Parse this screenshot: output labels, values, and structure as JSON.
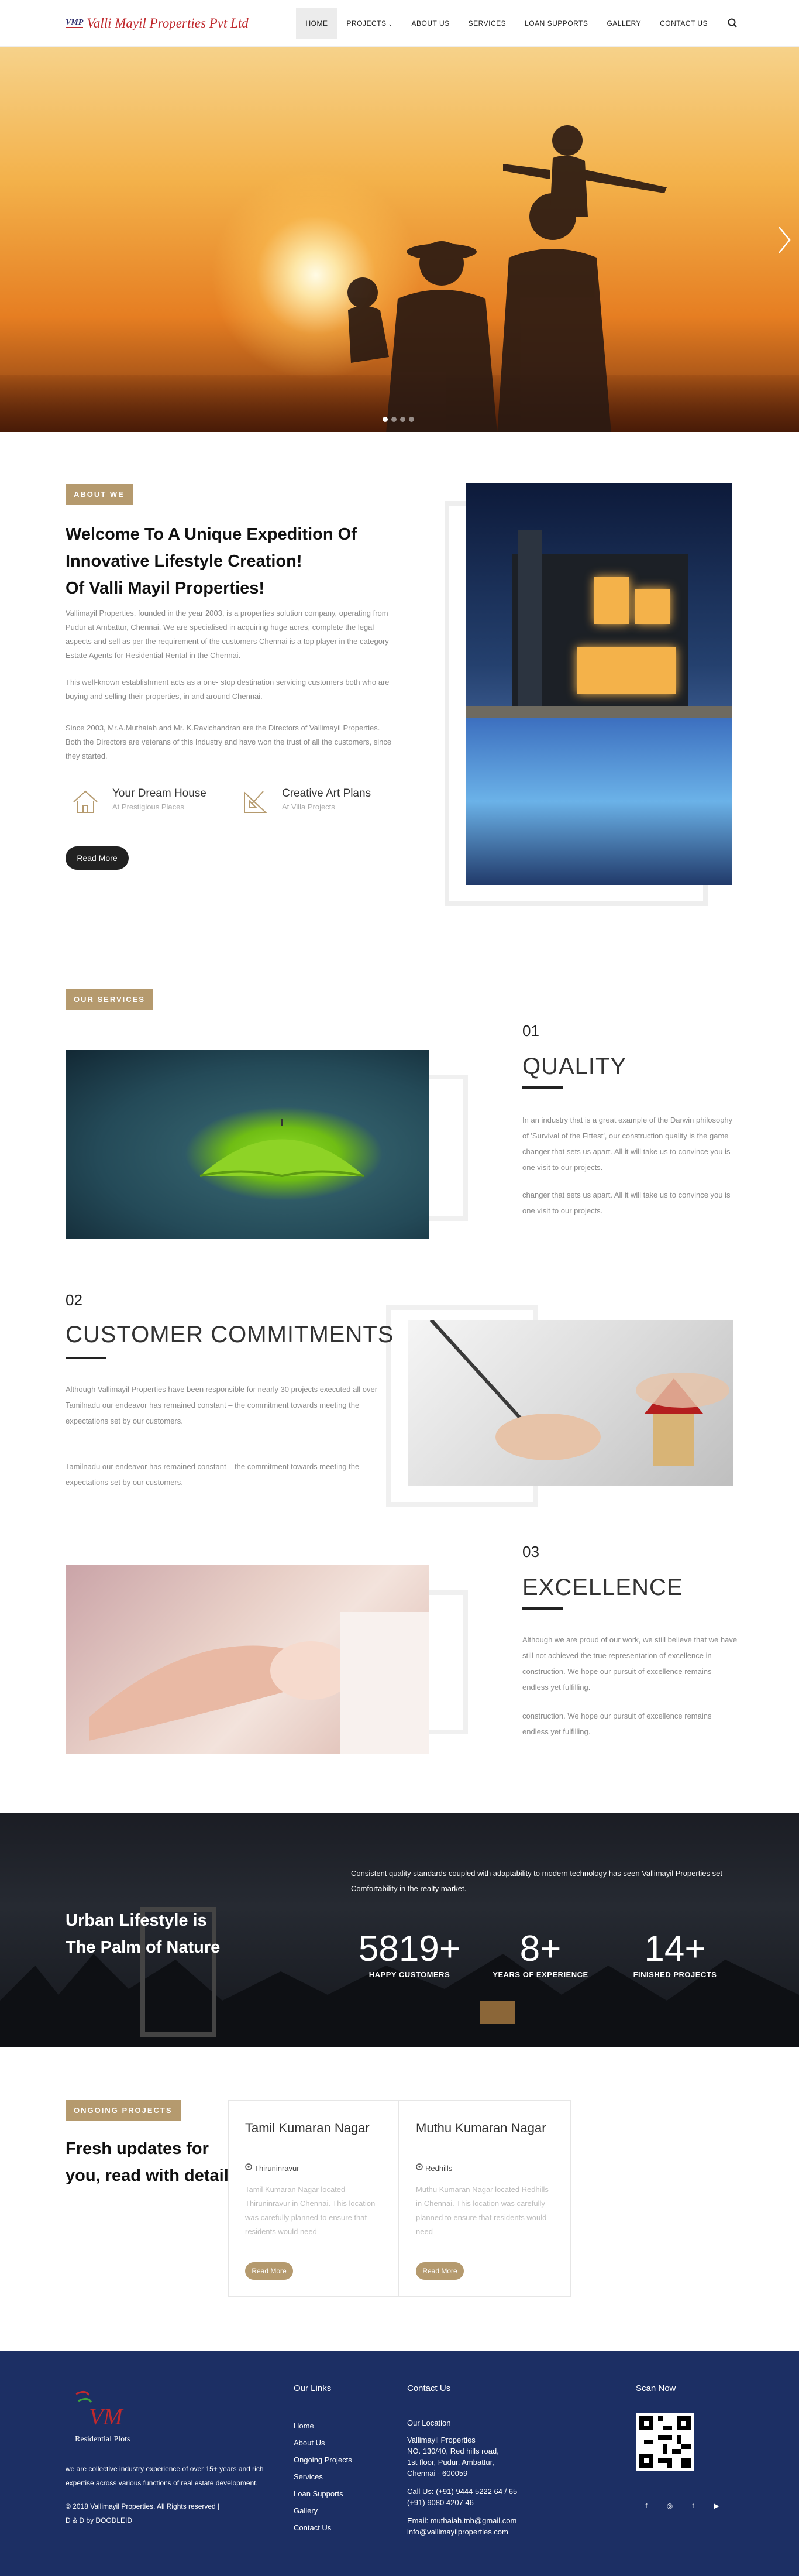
{
  "header": {
    "logo_mark": "VMP",
    "logo_name": "Valli Mayil Properties Pvt Ltd",
    "nav": [
      {
        "label": "HOME"
      },
      {
        "label": "PROJECTS"
      },
      {
        "label": "ABOUT US"
      },
      {
        "label": "SERVICES"
      },
      {
        "label": "LOAN SUPPORTS"
      },
      {
        "label": "GALLERY"
      },
      {
        "label": "CONTACT US"
      }
    ],
    "projects_caret": "⌄"
  },
  "hero": {
    "next_arrow": "›",
    "slides": 4,
    "active_slide": 1
  },
  "about": {
    "tag": "ABOUT WE",
    "title_lines": [
      "Welcome To A Unique Expedition Of",
      "Innovative Lifestyle Creation!",
      "Of Valli Mayil Properties!"
    ],
    "p1": "Vallimayil Properties, founded in the year 2003, is a properties solution company, operating from Pudur at Ambattur, Chennai. We are specialised in acquiring huge acres, complete the legal aspects and sell as per the requirement of the customers Chennai is a top player in the category Estate Agents for Residential Rental in the Chennai.",
    "p2": "This well-known establishment acts as a one- stop destination servicing customers both who are buying and selling their properties, in and around Chennai.",
    "p3": "Since 2003, Mr.A.Muthaiah and Mr. K.Ravichandran are the Directors of Vallimayil Properties. Both the Directors are veterans of this Industry and have won the trust of all the customers, since they started.",
    "features": [
      {
        "title": "Your Dream House",
        "sub": "At Prestigious Places",
        "icon": "house-icon"
      },
      {
        "title": "Creative Art Plans",
        "sub": "At Villa Projects",
        "icon": "ruler-icon"
      }
    ],
    "button": "Read More"
  },
  "services": {
    "tag": "OUR SERVICES",
    "items": [
      {
        "num": "01",
        "title": "QUALITY",
        "p1": "In an industry that is a great example of the Darwin philosophy of 'Survival of the Fittest', our construction quality is the game changer that sets us apart. All it will take us to convince you is one visit to our projects.",
        "p2": "changer that sets us apart. All it will take us to convince you is one visit to our projects."
      },
      {
        "num": "02",
        "title": "CUSTOMER COMMITMENTS",
        "p1": "Although Vallimayil Properties have been responsible for nearly 30 projects executed all over Tamilnadu our endeavor has remained constant – the commitment towards meeting the expectations set by our customers.",
        "p2": "Tamilnadu our endeavor has remained constant – the commitment towards meeting the expectations set by our customers."
      },
      {
        "num": "03",
        "title": "EXCELLENCE",
        "p1": "Although we are proud of our work, we still believe that we have still not achieved the true representation of excellence in construction. We hope our pursuit of excellence remains endless yet fulfilling.",
        "p2": "construction. We hope our pursuit of excellence remains endless yet fulfilling."
      }
    ]
  },
  "stats": {
    "tagline": "Urban Lifestyle is The Palm of Nature",
    "text": "Consistent quality standards coupled with adaptability to modern technology has seen Vallimayil Properties set Comfortability in the realty market.",
    "items": [
      {
        "num": "5819+",
        "label": "HAPPY CUSTOMERS"
      },
      {
        "num": "8+",
        "label": "YEARS OF EXPERIENCE"
      },
      {
        "num": "14+",
        "label": "FINISHED PROJECTS"
      }
    ]
  },
  "projects": {
    "tag": "ONGOING PROJECTS",
    "heading": "Fresh updates for you, read with detail.",
    "cards": [
      {
        "title": "Tamil Kumaran Nagar",
        "loc": "Thiruninravur",
        "text": "Tamil Kumaran Nagar located Thiruninravur in Chennai. This location was carefully planned to ensure that residents would need",
        "button": "Read More"
      },
      {
        "title": "Muthu Kumaran Nagar",
        "loc": "Redhills",
        "text": "Muthu Kumaran Nagar located Redhills in Chennai. This location was carefully planned to ensure that residents would need",
        "button": "Read More"
      }
    ]
  },
  "footer": {
    "logo_text": "VM",
    "logo_caption": "Residential Plots",
    "about": "we are collective industry experience of over 15+ years and rich expertise across various functions of real estate development.",
    "copyright": "© 2018 Vallimayil Properties. All Rights reserved |",
    "credit": "D & D by DOODLEID",
    "links_head": "Our Links",
    "links": [
      "Home",
      "About Us",
      "Ongoing Projects",
      "Services",
      "Loan Supports",
      "Gallery",
      "Contact Us"
    ],
    "contact_head": "Contact Us",
    "location_label": "Our Location",
    "address": [
      "Vallimayil Properties",
      "NO. 130/40, Red hills road,",
      "1st floor, Pudur, Ambattur,",
      "Chennai - 600059"
    ],
    "phone": "Call Us: (+91) 9444 5222 64 / 65",
    "phone2": "(+91) 9080 4207 46",
    "email": "Email: muthaiah.tnb@gmail.com",
    "email2": "info@vallimayilproperties.com",
    "scan_head": "Scan Now",
    "socials": [
      "f",
      "◎",
      "t",
      "▶"
    ]
  },
  "colors": {
    "accent": "#b59a6e",
    "footer_bg": "#1c2f64",
    "brand_red": "#c0292d"
  }
}
